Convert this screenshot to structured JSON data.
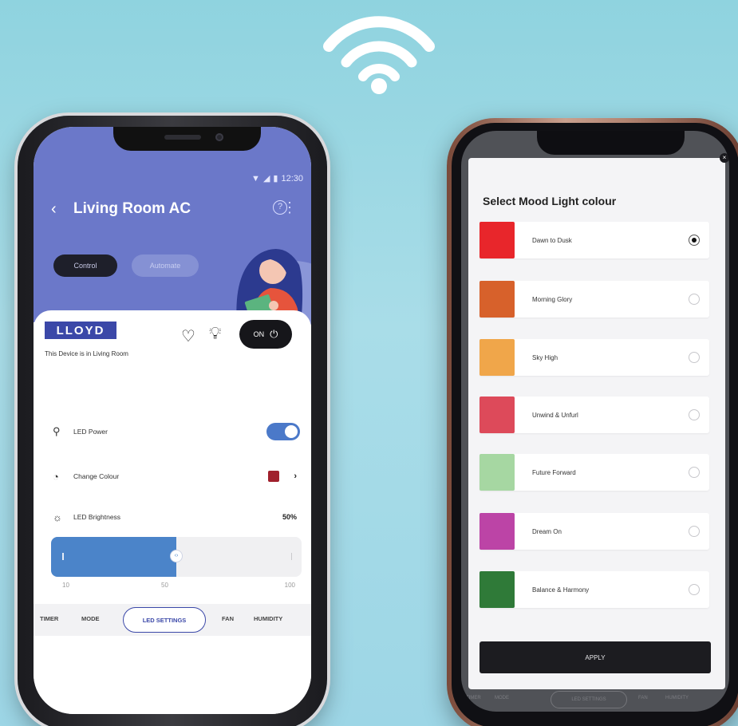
{
  "colors": {
    "background": "#9dd6e6",
    "header": "#6b78c9",
    "accent": "#4b79c9",
    "brand": "#3b48a8"
  },
  "left_phone": {
    "status_bar": {
      "time": "12:30",
      "icons": [
        "wifi-icon",
        "signal-icon",
        "battery-icon"
      ]
    },
    "header": {
      "back_label": "‹",
      "title": "Living Room AC",
      "help_label": "?",
      "more_label": "⋮",
      "tabs": [
        {
          "label": "Control",
          "active": true
        },
        {
          "label": "Automate",
          "active": false
        }
      ]
    },
    "device": {
      "logo_text": "LLOYD",
      "location_text": "This Device is in Living Room",
      "power_label": "ON",
      "power_on": true
    },
    "controls": {
      "led_power_label": "LED Power",
      "led_power_on": true,
      "change_colour_label": "Change Colour",
      "change_colour_swatch": "#a0202c",
      "brightness_label": "LED Brightness",
      "brightness_value_text": "50%",
      "brightness_value": 50,
      "brightness_min": 10,
      "brightness_max": 100,
      "scale_labels": [
        "10",
        "50",
        "100"
      ]
    },
    "tabbar": {
      "items": [
        "TIMER",
        "MODE",
        "LED SETTINGS",
        "FAN",
        "HUMIDITY"
      ],
      "active": "LED SETTINGS"
    }
  },
  "right_phone": {
    "modal": {
      "title": "Select Mood Light colour",
      "options": [
        {
          "label": "Dawn to Dusk",
          "color": "#e8262b",
          "selected": true
        },
        {
          "label": "Morning Glory",
          "color": "#d7612b",
          "selected": false
        },
        {
          "label": "Sky High",
          "color": "#f0a64a",
          "selected": false
        },
        {
          "label": "Unwind & Unfurl",
          "color": "#dd4a5a",
          "selected": false
        },
        {
          "label": "Future Forward",
          "color": "#a6d7a2",
          "selected": false
        },
        {
          "label": "Dream On",
          "color": "#bc44a6",
          "selected": false
        },
        {
          "label": "Balance & Harmony",
          "color": "#2f7a38",
          "selected": false
        }
      ],
      "apply_label": "APPLY"
    },
    "background_tabbar": {
      "items": [
        "TIMER",
        "MODE",
        "LED SETTINGS",
        "FAN",
        "HUMIDITY"
      ]
    }
  }
}
